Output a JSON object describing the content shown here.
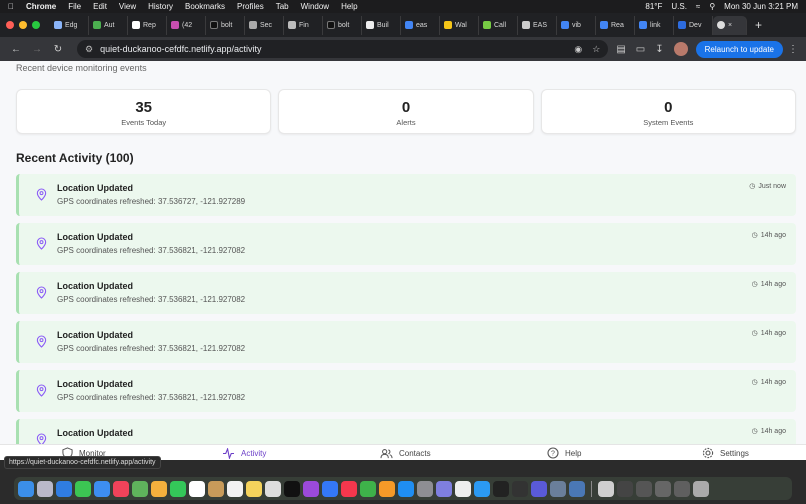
{
  "menubar": {
    "app": "Chrome",
    "items": [
      "File",
      "Edit",
      "View",
      "History",
      "Bookmarks",
      "Profiles",
      "Tab",
      "Window",
      "Help"
    ],
    "temperature": "81°F",
    "input_source": "U.S.",
    "datetime": "Mon 30 Jun  3:21 PM"
  },
  "tabs": [
    "Edg",
    "Aut",
    "Rep",
    "(42",
    "bolt",
    "Sec",
    "Fin",
    "bolt",
    "Buil",
    "eas",
    "Wal",
    "Call",
    "EAS",
    "vib",
    "Rea",
    "link",
    "Dev",
    ""
  ],
  "toolbar": {
    "url": "quiet-duckanoo-cefdfc.netlify.app/activity",
    "relaunch_label": "Relaunch to update"
  },
  "page": {
    "subtitle": "Recent device monitoring events",
    "stats": [
      {
        "value": "35",
        "label": "Events Today"
      },
      {
        "value": "0",
        "label": "Alerts"
      },
      {
        "value": "0",
        "label": "System Events"
      }
    ],
    "section_title": "Recent Activity (100)",
    "items": [
      {
        "title": "Location Updated",
        "desc": "GPS coordinates refreshed: 37.536727, -121.927289",
        "time": "Just now"
      },
      {
        "title": "Location Updated",
        "desc": "GPS coordinates refreshed: 37.536821, -121.927082",
        "time": "14h ago"
      },
      {
        "title": "Location Updated",
        "desc": "GPS coordinates refreshed: 37.536821, -121.927082",
        "time": "14h ago"
      },
      {
        "title": "Location Updated",
        "desc": "GPS coordinates refreshed: 37.536821, -121.927082",
        "time": "14h ago"
      },
      {
        "title": "Location Updated",
        "desc": "GPS coordinates refreshed: 37.536821, -121.927082",
        "time": "14h ago"
      },
      {
        "title": "Location Updated",
        "desc": "",
        "time": "14h ago"
      }
    ]
  },
  "bottom_nav": {
    "monitor": "Monitor",
    "activity": "Activity",
    "contacts": "Contacts",
    "help": "Help",
    "settings": "Settings"
  },
  "status_url": "https://quiet-duckanoo-cefdfc.netlify.app/activity",
  "colors": {
    "accent": "#6c3fc8",
    "item_bg": "#ecf8ee",
    "item_border": "#a8e0b1",
    "relaunch": "#1a73e8"
  },
  "dock_apps": [
    "finder-icon",
    "launchpad-icon",
    "safari-icon",
    "messages-icon",
    "mail-icon",
    "music-icon",
    "maps-icon",
    "photos-icon",
    "facetime-icon",
    "calendar-icon",
    "notes-icon",
    "reminders-icon",
    "finder-icon",
    "tv-icon",
    "podcasts-icon",
    "news-icon",
    "numbers-icon",
    "pages-icon",
    "appstore-icon",
    "settings-icon",
    "chrome-icon",
    "editor-icon",
    "terminal-icon",
    "other-icon",
    "other-icon",
    "other-icon",
    "other-icon",
    "trash-icon"
  ]
}
